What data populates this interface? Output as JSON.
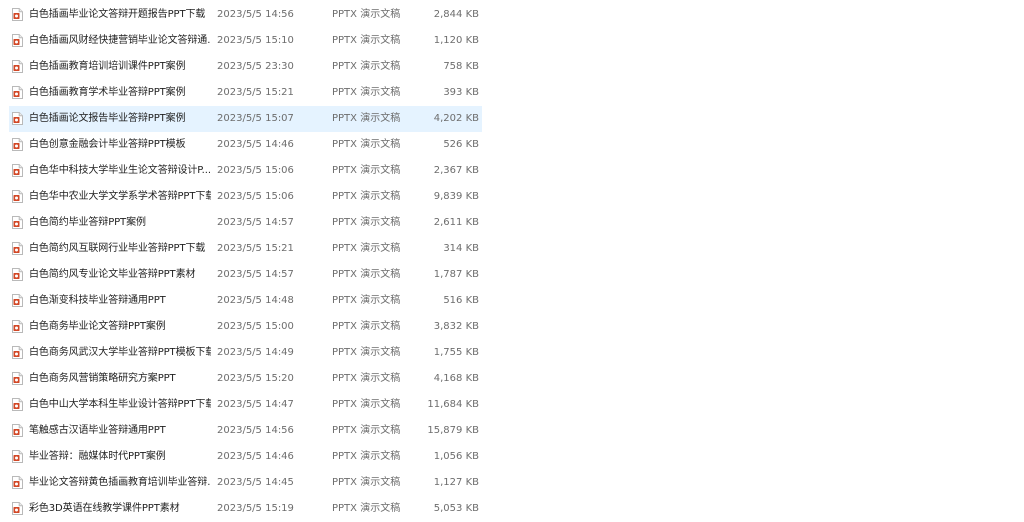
{
  "files": [
    {
      "name": "白色插画毕业论文答辩开题报告PPT下载",
      "date": "2023/5/5 14:56",
      "type": "PPTX 演示文稿",
      "size": "2,844 KB"
    },
    {
      "name": "白色插画风财经快捷营销毕业论文答辩通...",
      "date": "2023/5/5 15:10",
      "type": "PPTX 演示文稿",
      "size": "1,120 KB"
    },
    {
      "name": "白色插画教育培训培训课件PPT案例",
      "date": "2023/5/5 23:30",
      "type": "PPTX 演示文稿",
      "size": "758 KB"
    },
    {
      "name": "白色插画教育学术毕业答辩PPT案例",
      "date": "2023/5/5 15:21",
      "type": "PPTX 演示文稿",
      "size": "393 KB"
    },
    {
      "name": "白色插画论文报告毕业答辩PPT案例",
      "date": "2023/5/5 15:07",
      "type": "PPTX 演示文稿",
      "size": "4,202 KB"
    },
    {
      "name": "白色创意金融会计毕业答辩PPT模板",
      "date": "2023/5/5 14:46",
      "type": "PPTX 演示文稿",
      "size": "526 KB"
    },
    {
      "name": "白色华中科技大学毕业生论文答辩设计P...",
      "date": "2023/5/5 15:06",
      "type": "PPTX 演示文稿",
      "size": "2,367 KB"
    },
    {
      "name": "白色华中农业大学文学系学术答辩PPT下载",
      "date": "2023/5/5 15:06",
      "type": "PPTX 演示文稿",
      "size": "9,839 KB"
    },
    {
      "name": "白色简约毕业答辩PPT案例",
      "date": "2023/5/5 14:57",
      "type": "PPTX 演示文稿",
      "size": "2,611 KB"
    },
    {
      "name": "白色简约风互联网行业毕业答辩PPT下载",
      "date": "2023/5/5 15:21",
      "type": "PPTX 演示文稿",
      "size": "314 KB"
    },
    {
      "name": "白色简约风专业论文毕业答辩PPT素材",
      "date": "2023/5/5 14:57",
      "type": "PPTX 演示文稿",
      "size": "1,787 KB"
    },
    {
      "name": "白色渐变科技毕业答辩通用PPT",
      "date": "2023/5/5 14:48",
      "type": "PPTX 演示文稿",
      "size": "516 KB"
    },
    {
      "name": "白色商务毕业论文答辩PPT案例",
      "date": "2023/5/5 15:00",
      "type": "PPTX 演示文稿",
      "size": "3,832 KB"
    },
    {
      "name": "白色商务风武汉大学毕业答辩PPT模板下载",
      "date": "2023/5/5 14:49",
      "type": "PPTX 演示文稿",
      "size": "1,755 KB"
    },
    {
      "name": "白色商务风营销策略研究方案PPT",
      "date": "2023/5/5 15:20",
      "type": "PPTX 演示文稿",
      "size": "4,168 KB"
    },
    {
      "name": "白色中山大学本科生毕业设计答辩PPT下载",
      "date": "2023/5/5 14:47",
      "type": "PPTX 演示文稿",
      "size": "11,684 KB"
    },
    {
      "name": "笔触感古汉语毕业答辩通用PPT",
      "date": "2023/5/5 14:56",
      "type": "PPTX 演示文稿",
      "size": "15,879 KB"
    },
    {
      "name": "毕业答辩：融媒体时代PPT案例",
      "date": "2023/5/5 14:46",
      "type": "PPTX 演示文稿",
      "size": "1,056 KB"
    },
    {
      "name": "毕业论文答辩黄色插画教育培训毕业答辩...",
      "date": "2023/5/5 14:45",
      "type": "PPTX 演示文稿",
      "size": "1,127 KB"
    },
    {
      "name": "彩色3D英语在线教学课件PPT素材",
      "date": "2023/5/5 15:19",
      "type": "PPTX 演示文稿",
      "size": "5,053 KB"
    }
  ],
  "selected_index": 4,
  "colors": {
    "selection": "#e5f3ff",
    "icon_accent": "#d24726",
    "secondary_text": "#6d6d6d"
  },
  "icon": "pptx-file-icon"
}
